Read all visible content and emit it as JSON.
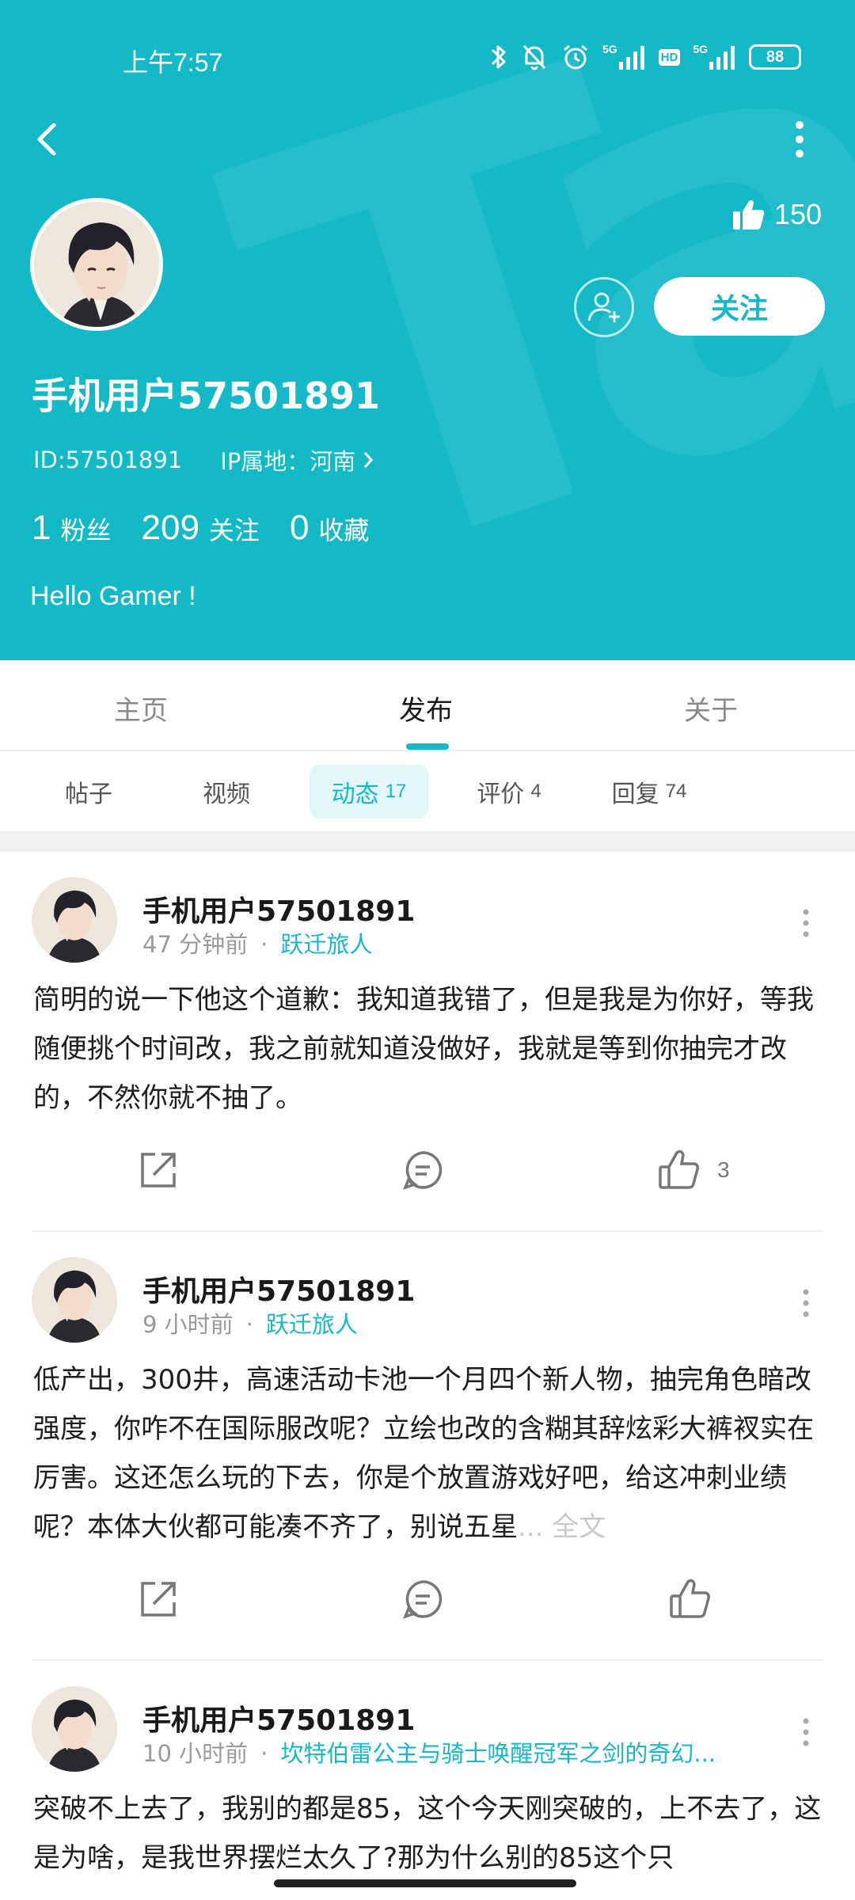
{
  "status_bar": {
    "time": "上午7:57",
    "battery": "88",
    "net1": "5G",
    "hd": "HD",
    "net2": "5G"
  },
  "header": {
    "like_count": "150",
    "follow_label": "关注",
    "username": "手机用户57501891",
    "user_id": "ID:57501891",
    "ip_location": "IP属地：河南",
    "stats": [
      {
        "num": "1",
        "label": "粉丝"
      },
      {
        "num": "209",
        "label": "关注"
      },
      {
        "num": "0",
        "label": "收藏"
      }
    ],
    "bio": "Hello Gamer !",
    "accent_color": "#14b9c8"
  },
  "main_tabs": [
    {
      "label": "主页"
    },
    {
      "label": "发布"
    },
    {
      "label": "关于"
    }
  ],
  "sub_tabs": [
    {
      "label": "帖子",
      "count": ""
    },
    {
      "label": "视频",
      "count": ""
    },
    {
      "label": "动态",
      "count": "17"
    },
    {
      "label": "评价",
      "count": "4"
    },
    {
      "label": "回复",
      "count": "74"
    }
  ],
  "posts": [
    {
      "author": "手机用户57501891",
      "time": "47 分钟前",
      "dot": "·",
      "tag": "跃迁旅人",
      "text": "简明的说一下他这个道歉：我知道我错了，但是我是为你好，等我随便挑个时间改，我之前就知道没做好，我就是等到你抽完才改的，不然你就不抽了。",
      "likes": "3"
    },
    {
      "author": "手机用户57501891",
      "time": "9 小时前",
      "dot": "·",
      "tag": "跃迁旅人",
      "text": "低产出，300井，高速活动卡池一个月四个新人物，抽完角色暗改强度，你咋不在国际服改呢？立绘也改的含糊其辞炫彩大裤衩实在厉害。这还怎么玩的下去，你是个放置游戏好吧，给这冲刺业绩呢？本体大伙都可能凑不齐了，别说五星",
      "more": "... 全文",
      "likes": ""
    },
    {
      "author": "手机用户57501891",
      "time": "10 小时前",
      "dot": "·",
      "tag": "坎特伯雷公主与骑士唤醒冠军之剑的奇幻...",
      "text": "突破不上去了，我别的都是85，这个今天刚突破的，上不去了，这是为啥，是我世界摆烂太久了?那为什么别的85这个只"
    }
  ]
}
